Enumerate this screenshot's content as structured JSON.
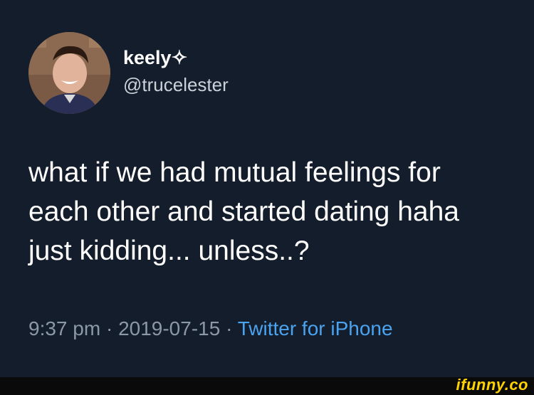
{
  "tweet": {
    "display_name": "keely✧",
    "handle": "@trucelester",
    "text_lines": [
      "what if we had mutual feelings for",
      "each other and started dating haha",
      "just kidding... unless..?"
    ],
    "time": "9:37 pm",
    "separator": " · ",
    "date": "2019-07-15",
    "source": "Twitter for iPhone"
  },
  "watermark": "ifunny.co",
  "colors": {
    "background": "#141d2b",
    "text": "#ffffff",
    "muted": "#8b98a5",
    "link": "#4aa3f0",
    "watermark": "#ffd200"
  }
}
